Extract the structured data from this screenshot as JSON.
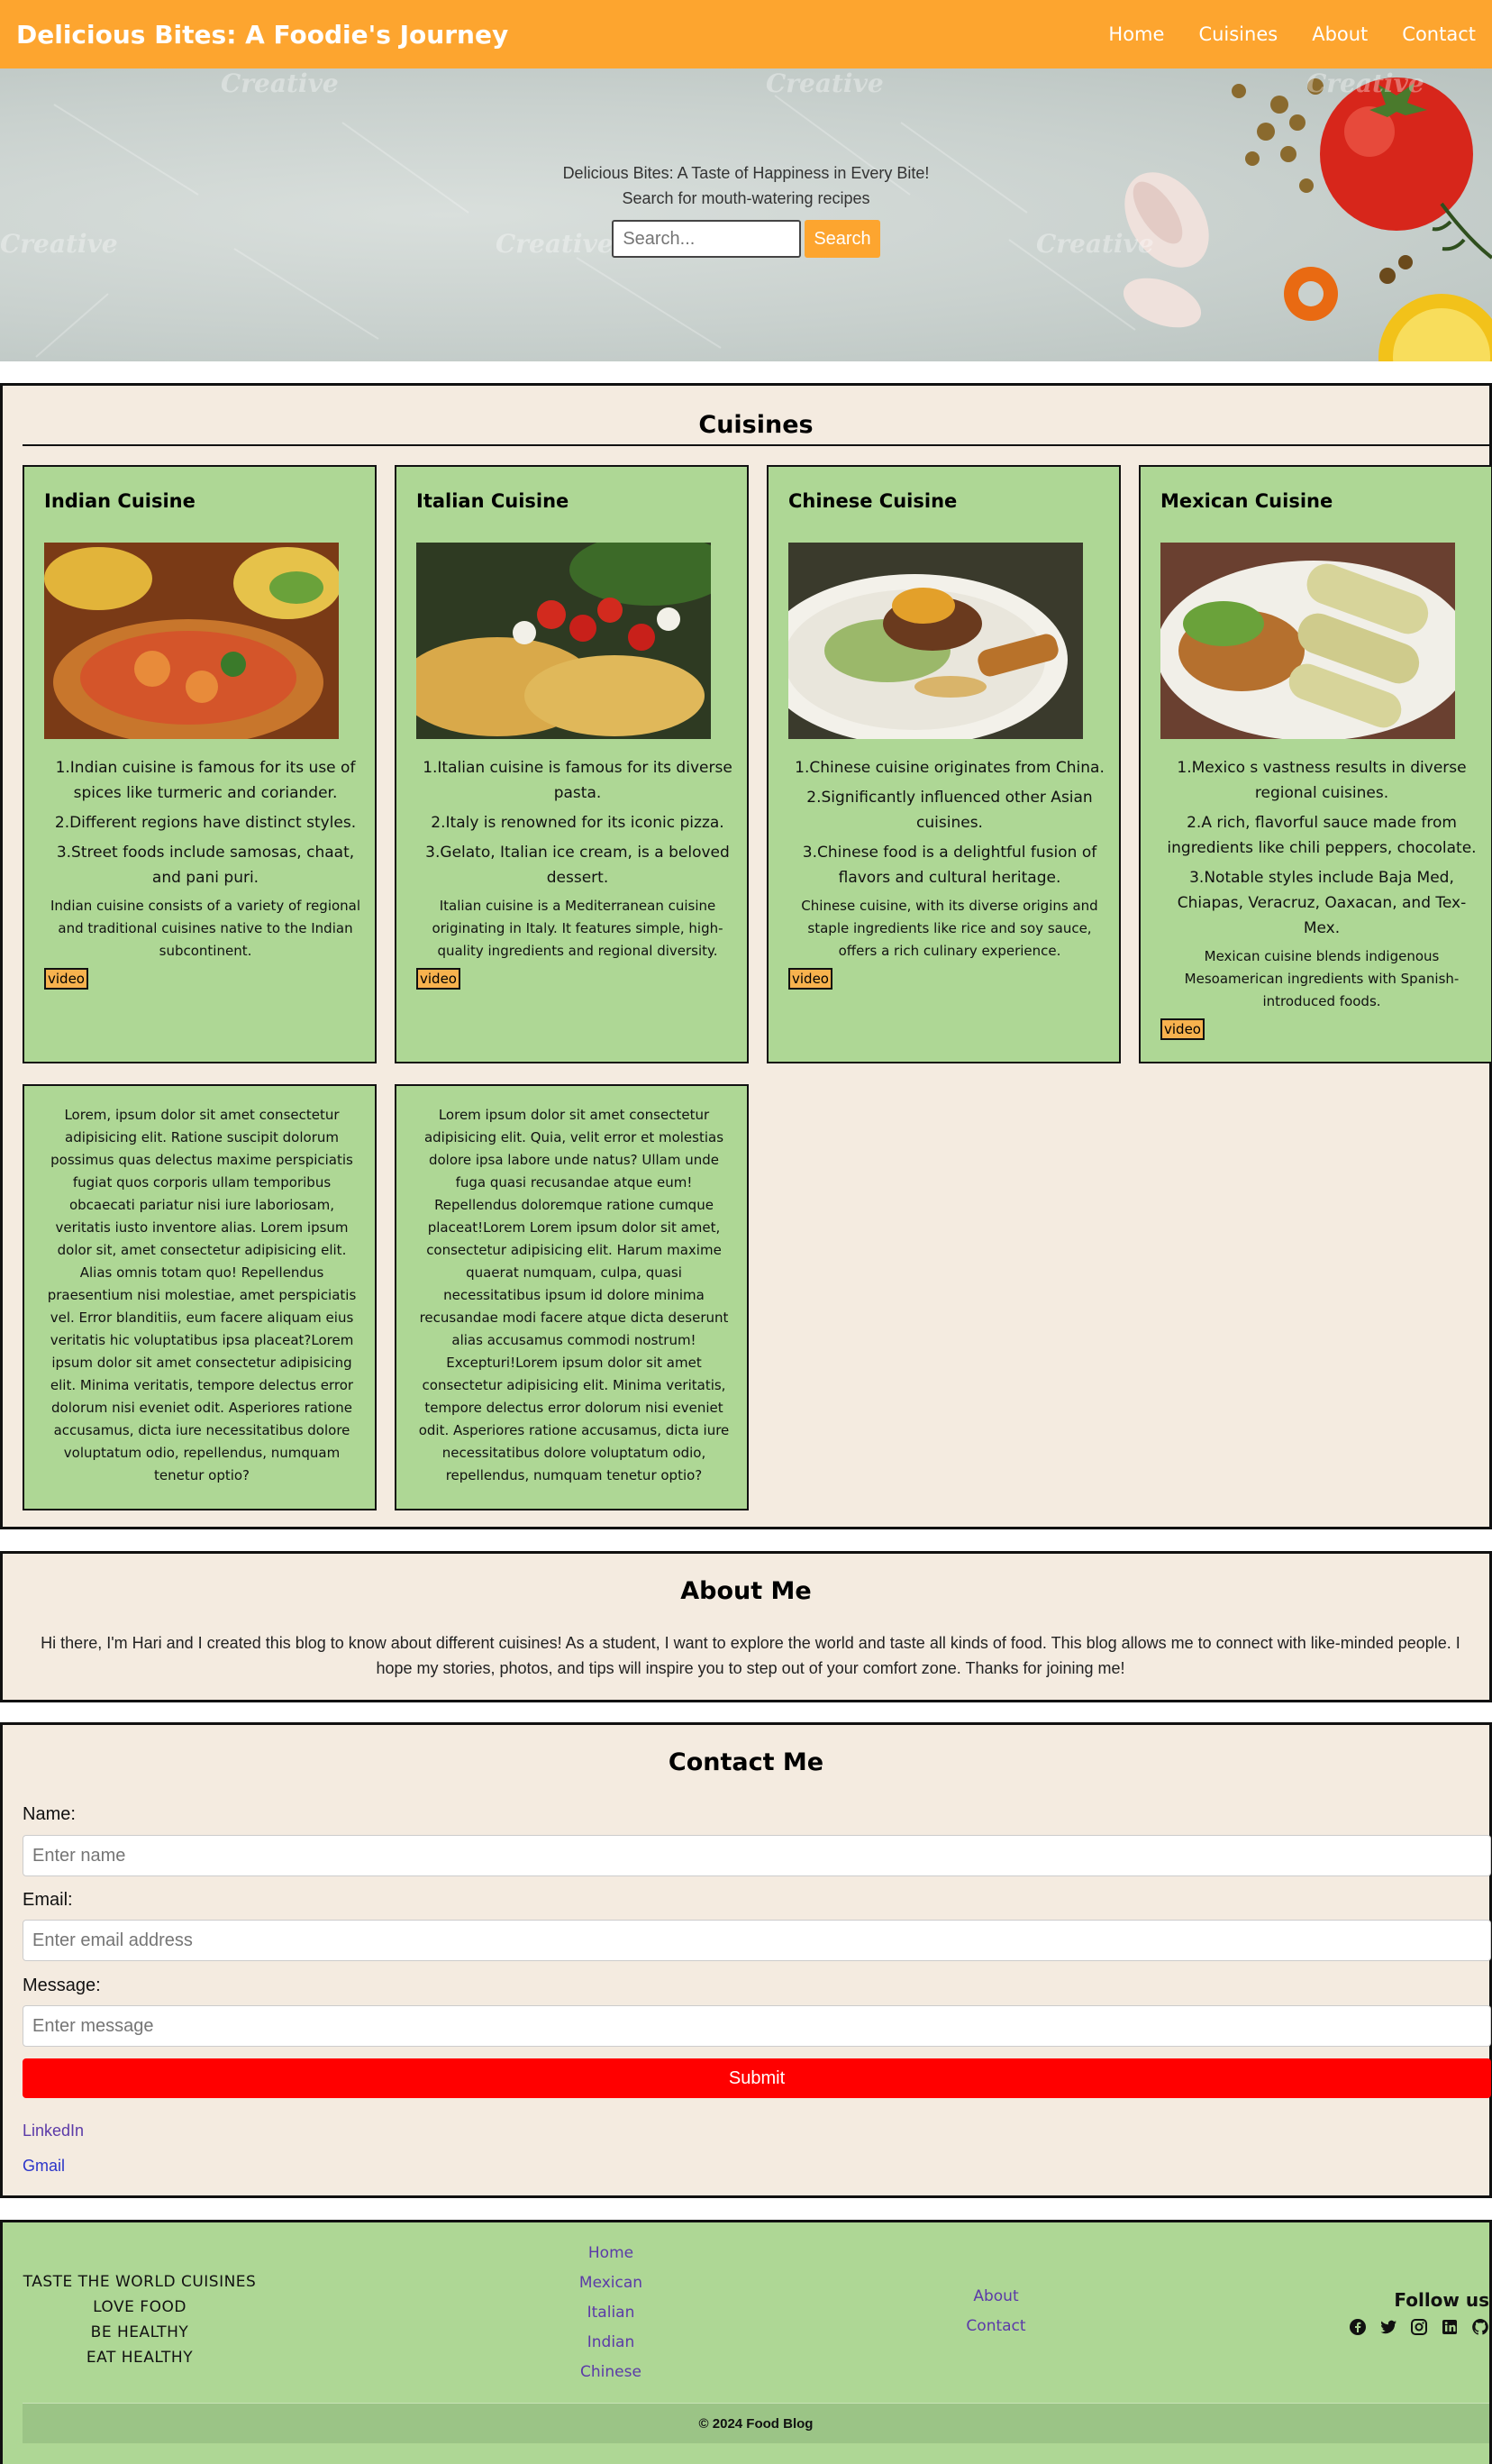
{
  "nav": {
    "brand": "Delicious Bites: A Foodie's Journey",
    "links": [
      "Home",
      "Cuisines",
      "About",
      "Contact"
    ]
  },
  "hero": {
    "tagline": "Delicious Bites: A Taste of Happiness in Every Bite!",
    "subline": "Search for mouth-watering recipes",
    "search_placeholder": "Search...",
    "search_button": "Search",
    "watermark": "Creative"
  },
  "cuisines": {
    "title": "Cuisines",
    "cards": [
      {
        "title": "Indian Cuisine",
        "points": [
          "1.Indian cuisine is famous for its use of spices like turmeric and coriander.",
          "2.Different regions have distinct styles.",
          "3.Street foods include samosas, chaat, and pani puri."
        ],
        "description": "Indian cuisine consists of a variety of regional and traditional cuisines native to the Indian subcontinent.",
        "video_label": "video"
      },
      {
        "title": "Italian Cuisine",
        "points": [
          "1.Italian cuisine is famous for its diverse pasta.",
          "2.Italy is renowned for its iconic pizza.",
          "3.Gelato, Italian ice cream, is a beloved dessert."
        ],
        "description": "Italian cuisine is a Mediterranean cuisine originating in Italy. It features simple, high-quality ingredients and regional diversity.",
        "video_label": "video"
      },
      {
        "title": "Chinese Cuisine",
        "points": [
          "1.Chinese cuisine originates from China.",
          "2.Significantly influenced other Asian cuisines.",
          "3.Chinese food is a delightful fusion of flavors and cultural heritage."
        ],
        "description": "Chinese cuisine, with its diverse origins and staple ingredients like rice and soy sauce, offers a rich culinary experience.",
        "video_label": "video"
      },
      {
        "title": "Mexican Cuisine",
        "points": [
          "1.Mexico s vastness results in diverse regional cuisines.",
          "2.A rich, flavorful sauce made from ingredients like chili peppers, chocolate.",
          "3.Notable styles include Baja Med, Chiapas, Veracruz, Oaxacan, and Tex-Mex."
        ],
        "description": "Mexican cuisine blends indigenous Mesoamerican ingredients with Spanish-introduced foods.",
        "video_label": "video"
      }
    ],
    "lorem_cards": [
      "Lorem, ipsum dolor sit amet consectetur adipisicing elit. Ratione suscipit dolorum possimus quas delectus maxime perspiciatis fugiat quos corporis ullam temporibus obcaecati pariatur nisi iure laboriosam, veritatis iusto inventore alias. Lorem ipsum dolor sit, amet consectetur adipisicing elit. Alias omnis totam quo! Repellendus praesentium nisi molestiae, amet perspiciatis vel. Error blanditiis, eum facere aliquam eius veritatis hic voluptatibus ipsa placeat?Lorem ipsum dolor sit amet consectetur adipisicing elit. Minima veritatis, tempore delectus error dolorum nisi eveniet odit. Asperiores ratione accusamus, dicta iure necessitatibus dolore voluptatum odio, repellendus, numquam tenetur optio?",
      "Lorem ipsum dolor sit amet consectetur adipisicing elit. Quia, velit error et molestias dolore ipsa labore unde natus? Ullam unde fuga quasi recusandae atque eum! Repellendus doloremque ratione cumque placeat!Lorem Lorem ipsum dolor sit amet, consectetur adipisicing elit. Harum maxime quaerat numquam, culpa, quasi necessitatibus ipsum id dolore minima recusandae modi facere atque dicta deserunt alias accusamus commodi nostrum! Excepturi!Lorem ipsum dolor sit amet consectetur adipisicing elit. Minima veritatis, tempore delectus error dolorum nisi eveniet odit. Asperiores ratione accusamus, dicta iure necessitatibus dolore voluptatum odio, repellendus, numquam tenetur optio?"
    ]
  },
  "about": {
    "title": "About Me",
    "text": "Hi there, I'm Hari and I created this blog to know about different cuisines! As a student, I want to explore the world and taste all kinds of food. This blog allows me to connect with like-minded people. I hope my stories, photos, and tips will inspire you to step out of your comfort zone. Thanks for joining me!"
  },
  "contact": {
    "title": "Contact Me",
    "name_label": "Name:",
    "name_placeholder": "Enter name",
    "email_label": "Email:",
    "email_placeholder": "Enter email address",
    "message_label": "Message:",
    "message_placeholder": "Enter message",
    "submit": "Submit",
    "linkedin": "LinkedIn",
    "gmail": "Gmail"
  },
  "footer": {
    "tagline": [
      "TASTE THE WORLD CUISINES",
      "LOVE FOOD",
      "BE HEALTHY",
      "EAT HEALTHY"
    ],
    "links_col1": [
      "Home",
      "Mexican",
      "Italian",
      "Indian",
      "Chinese"
    ],
    "links_col2": [
      "About",
      "Contact"
    ],
    "follow_title": "Follow us",
    "social_icons": [
      "facebook-icon",
      "twitter-icon",
      "instagram-icon",
      "linkedin-icon",
      "github-icon"
    ],
    "copyright": "© 2024 Food Blog"
  },
  "colors": {
    "nav": "#fda52f",
    "section_bg": "#f4ebe0",
    "card_green": "#aed795",
    "submit_red": "#ff0000"
  }
}
